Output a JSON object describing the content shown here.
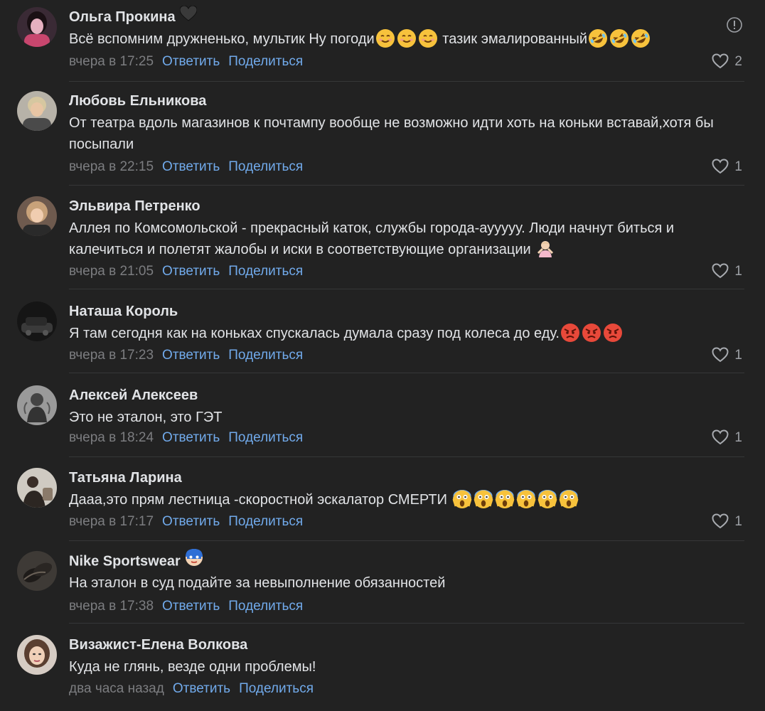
{
  "comments": [
    {
      "author": "Ольга Прокина",
      "author_badge": "black-heart-emoji",
      "text": "Всё вспомним дружненько, мультик Ну погоди",
      "emoji_group_1": [
        "smiling-face-emoji",
        "smiling-face-emoji",
        "smiling-face-emoji"
      ],
      "text_after": " тазик эмалированный",
      "emoji_group_2": [
        "rolling-laughing-emoji",
        "rolling-laughing-emoji",
        "rolling-laughing-emoji"
      ],
      "time": "вчера в 17:25",
      "reply_label": "Ответить",
      "share_label": "Поделиться",
      "likes": "2",
      "report_icon": "report-icon"
    },
    {
      "author": "Любовь Ельникова",
      "text": "От театра вдоль магазинов к почтампу вообще не возможно идти хоть на коньки вставай,хотя бы посыпали",
      "time": "вчера в 22:15",
      "reply_label": "Ответить",
      "share_label": "Поделиться",
      "likes": "1"
    },
    {
      "author": "Эльвира Петренко",
      "text": "Аллея по Комсомольской - прекрасный каток, службы города-аууууу. Люди начнут биться и калечиться и полетят жалобы и иски в соответствующие организации ",
      "emoji_group_1": [
        "person-gesturing-emoji"
      ],
      "time": "вчера в 21:05",
      "reply_label": "Ответить",
      "share_label": "Поделиться",
      "likes": "1"
    },
    {
      "author": "Наташа Король",
      "text": "Я там сегодня как на коньках спускалась думала сразу под колеса до еду.",
      "emoji_group_1": [
        "angry-face-emoji",
        "angry-face-emoji",
        "angry-face-emoji"
      ],
      "time": "вчера в 17:23",
      "reply_label": "Ответить",
      "share_label": "Поделиться",
      "likes": "1"
    },
    {
      "author": "Алексей Алексеев",
      "text": "Это не эталон, это ГЭТ",
      "time": "вчера в 18:24",
      "reply_label": "Ответить",
      "share_label": "Поделиться",
      "likes": "1"
    },
    {
      "author": "Татьяна Ларина",
      "text": "Дааа,это прям лестница -скоростной эскалатор СМЕРТИ ",
      "emoji_group_1": [
        "screaming-face-emoji",
        "screaming-face-emoji",
        "screaming-face-emoji",
        "screaming-face-emoji",
        "screaming-face-emoji",
        "screaming-face-emoji"
      ],
      "time": "вчера в 17:17",
      "reply_label": "Ответить",
      "share_label": "Поделиться",
      "likes": "1"
    },
    {
      "author": "Nike Sportswear",
      "author_badge": "superhero-mask-emoji",
      "text": "На эталон в суд подайте за невыполнение обязанностей",
      "time": "вчера в 17:38",
      "reply_label": "Ответить",
      "share_label": "Поделиться",
      "likes": ""
    },
    {
      "author": "Визажист-Елена Волкова",
      "text": "Куда не глянь, везде одни проблемы!",
      "time": "два часа назад",
      "reply_label": "Ответить",
      "share_label": "Поделиться",
      "likes": ""
    }
  ],
  "colors": {
    "background": "#222222",
    "text": "#e1e3e6",
    "secondary": "#7c7d80",
    "link": "#71aaeb",
    "divider": "#363738"
  }
}
